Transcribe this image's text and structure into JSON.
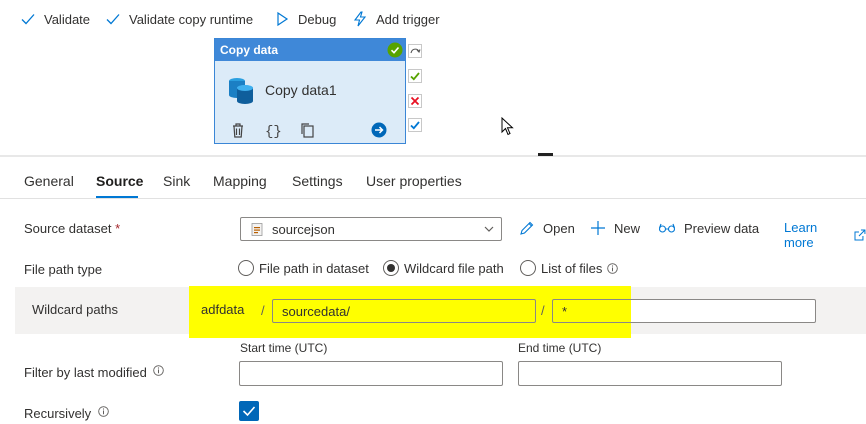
{
  "toolbar": {
    "validate": "Validate",
    "validate_runtime": "Validate copy runtime",
    "debug": "Debug",
    "add_trigger": "Add trigger"
  },
  "activity": {
    "type_label": "Copy data",
    "name": "Copy data1"
  },
  "tabs": [
    "General",
    "Source",
    "Sink",
    "Mapping",
    "Settings",
    "User properties"
  ],
  "active_tab": "Source",
  "source": {
    "dataset_label": "Source dataset",
    "required_mark": "*",
    "dataset_value": "sourcejson",
    "open": "Open",
    "new": "New",
    "preview": "Preview data",
    "learn_more": "Learn more",
    "file_path_type_label": "File path type",
    "radio_options": [
      "File path in dataset",
      "Wildcard file path",
      "List of files"
    ],
    "selected_radio": "Wildcard file path",
    "wildcard_label": "Wildcard paths",
    "container": "adfdata",
    "separator": "/",
    "folder_path": "sourcedata/",
    "file_name": "*",
    "start_time_label": "Start time (UTC)",
    "end_time_label": "End time (UTC)",
    "filter_label": "Filter by last modified",
    "recursively_label": "Recursively",
    "recursively_checked": true
  },
  "colors": {
    "accent": "#0078d4",
    "activity_header": "#3f88d8",
    "activity_body": "#dcebf8",
    "highlight": "#ffff00",
    "success": "#57a300",
    "fail": "#e81123"
  }
}
